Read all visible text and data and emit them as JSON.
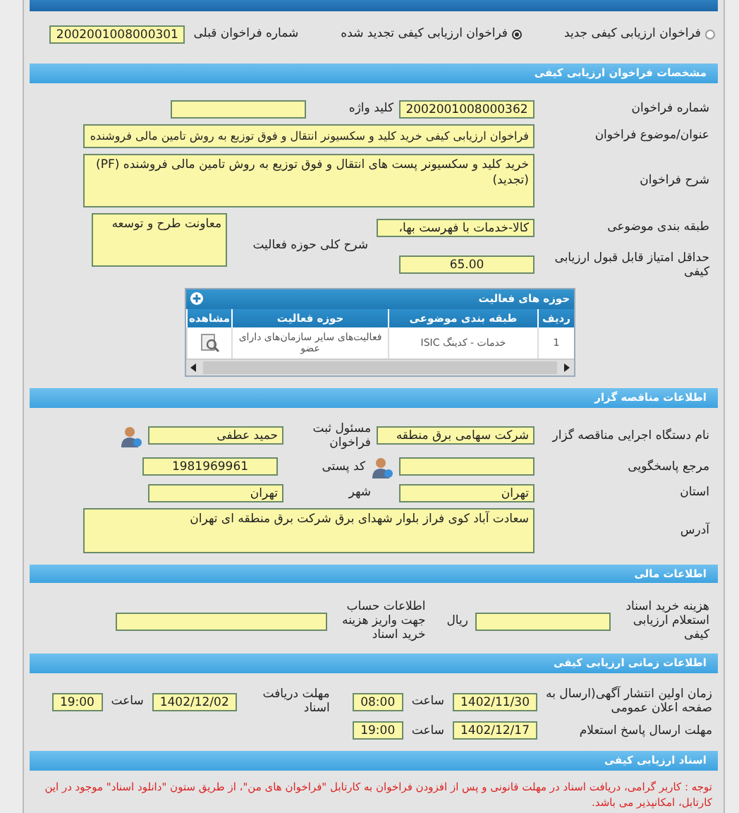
{
  "call_type": {
    "options": [
      {
        "label": "فراخوان ارزیابی کیفی جدید",
        "selected": false
      },
      {
        "label": "فراخوان ارزیابی کیفی تجدید شده",
        "selected": true
      }
    ],
    "previous_number": {
      "label": "شماره فراخوان قبلی",
      "value": "2002001008000301"
    }
  },
  "specs": {
    "title": "مشخصات فراخوان ارزیابی کیفی",
    "number": {
      "label": "شماره فراخوان",
      "value": "2002001008000362"
    },
    "keyword": {
      "label": "کلید واژه"
    },
    "subject": {
      "label": "عنوان/موضوع فراخوان",
      "value": "فراخوان ارزیابی کیفی خرید کلید و سکسیونر انتقال و فوق توزیع به روش تامین مالی فروشنده"
    },
    "description": {
      "label": "شرح فراخوان",
      "value": "خرید کلید و سکسیونر پست های انتقال و فوق توزیع به روش تامین مالی فروشنده (PF) (تجدید)"
    },
    "category": {
      "label": "طبقه بندی موضوعی",
      "value": "کالا-خدمات با فهرست بها،"
    },
    "activity_scope": {
      "label": "شرح کلی حوزه فعالیت",
      "value": "معاونت طرح و توسعه"
    },
    "min_score": {
      "label": "حداقل امتیاز قابل قبول ارزیابی کیفی",
      "value": "65.00"
    }
  },
  "activities": {
    "title": "حوزه های فعالیت",
    "columns": [
      "ردیف",
      "طبقه بندی موضوعی",
      "حوزه فعالیت",
      "مشاهده"
    ],
    "rows": [
      {
        "row": "1",
        "category": "خدمات - کدینگ ISIC",
        "scope": "فعالیت‌های سایر سازمان‌های دارای عضو"
      }
    ]
  },
  "contractor": {
    "title": "اطلاعات مناقصه گزار",
    "organization": {
      "label": "نام دستگاه اجرایی مناقصه گزار",
      "value": "شرکت سهامی برق منطقه"
    },
    "registrar": {
      "label": "مسئول ثبت فراخوان",
      "value": "حمید عطفی"
    },
    "reference": {
      "label": "مرجع پاسخگویی"
    },
    "postal_code": {
      "label": "کد پستی",
      "value": "1981969961"
    },
    "province": {
      "label": "استان",
      "value": "تهران"
    },
    "city": {
      "label": "شهر",
      "value": "تهران"
    },
    "address": {
      "label": "آدرس",
      "value": "سعادت آباد کوی فراز بلوار شهدای برق شرکت برق منطقه ای تهران"
    }
  },
  "finance": {
    "title": "اطلاعات مالی",
    "document_fee": {
      "label": "هزینه خرید اسناد استعلام ارزیابی کیفی",
      "unit": "ریال"
    },
    "account_info": {
      "label": "اطلاعات حساب جهت واریز هزینه خرید اسناد"
    }
  },
  "timing": {
    "title": "اطلاعات زمانی ارزیابی کیفی",
    "publish": {
      "label": "زمان اولین انتشار آگهی(ارسال به صفحه اعلان عمومی",
      "date": "1402/11/30",
      "time_label": "ساعت",
      "time": "08:00"
    },
    "doc_deadline": {
      "label": "مهلت دریافت اسناد",
      "date": "1402/12/02",
      "time_label": "ساعت",
      "time": "19:00"
    },
    "reply_deadline": {
      "label": "مهلت ارسال پاسخ استعلام",
      "date": "1402/12/17",
      "time_label": "ساعت",
      "time": "19:00"
    }
  },
  "documents": {
    "title": "اسناد ارزیابی کیفی",
    "note": "توجه : کاربر گرامی، دریافت اسناد در مهلت قانونی و پس از افزودن فراخوان به کارتابل \"فراخوان های من\"، از طریق ستون \"دانلود اسناد\" موجود در این کارتابل، امکانپذیر می باشد."
  }
}
